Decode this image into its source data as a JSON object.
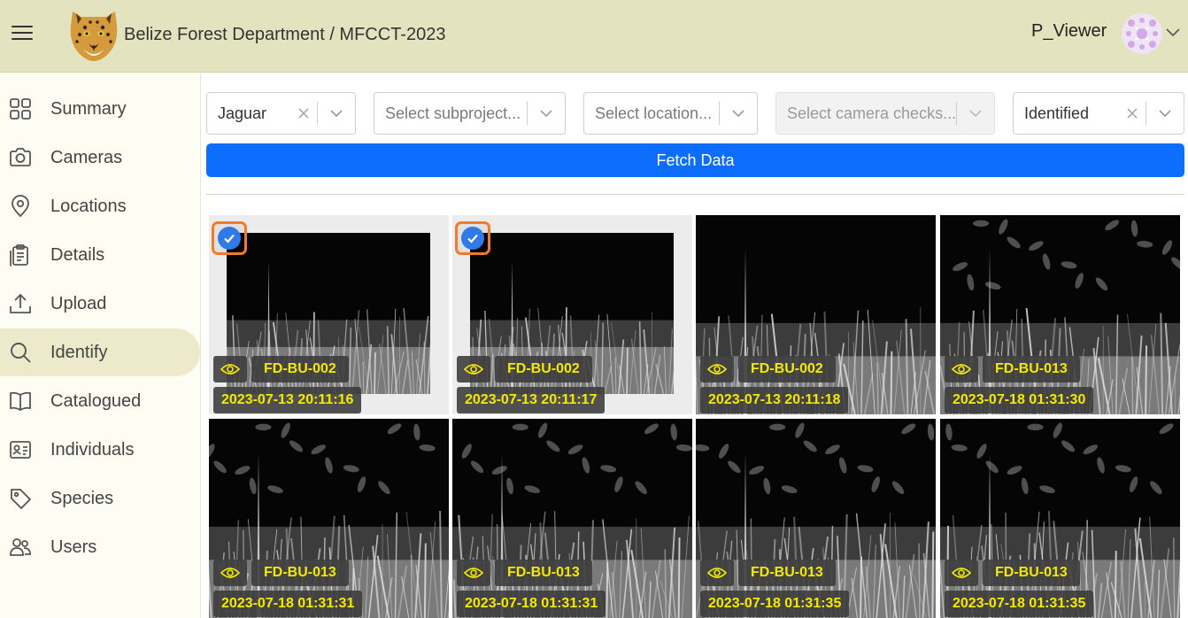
{
  "header": {
    "title": "Belize Forest Department / MFCCT-2023",
    "username": "P_Viewer",
    "menu_icon": "hamburger-menu-icon",
    "logo": "jaguar-logo"
  },
  "sidebar": {
    "items": [
      {
        "label": "Summary",
        "icon": "grid-icon"
      },
      {
        "label": "Cameras",
        "icon": "camera-icon"
      },
      {
        "label": "Locations",
        "icon": "map-pin-icon"
      },
      {
        "label": "Details",
        "icon": "clipboard-icon"
      },
      {
        "label": "Upload",
        "icon": "upload-icon"
      },
      {
        "label": "Identify",
        "icon": "search-icon",
        "active": true
      },
      {
        "label": "Catalogued",
        "icon": "book-icon"
      },
      {
        "label": "Individuals",
        "icon": "id-card-icon"
      },
      {
        "label": "Species",
        "icon": "tag-icon"
      },
      {
        "label": "Users",
        "icon": "users-icon"
      }
    ]
  },
  "filters": {
    "species": {
      "value": "Jaguar"
    },
    "subproject": {
      "placeholder": "Select subproject..."
    },
    "location": {
      "placeholder": "Select location..."
    },
    "camera_checks": {
      "placeholder": "Select camera checks...",
      "disabled": true
    },
    "status": {
      "value": "Identified"
    }
  },
  "fetch_button": {
    "label": "Fetch Data"
  },
  "images": [
    {
      "location": "FD-BU-002",
      "timestamp": "2023-07-13 20:11:16",
      "selected": true
    },
    {
      "location": "FD-BU-002",
      "timestamp": "2023-07-13 20:11:17",
      "selected": true
    },
    {
      "location": "FD-BU-002",
      "timestamp": "2023-07-13 20:11:18",
      "selected": false
    },
    {
      "location": "FD-BU-013",
      "timestamp": "2023-07-18 01:31:30",
      "selected": false
    },
    {
      "location": "FD-BU-013",
      "timestamp": "2023-07-18 01:31:31",
      "selected": false
    },
    {
      "location": "FD-BU-013",
      "timestamp": "2023-07-18 01:31:31",
      "selected": false
    },
    {
      "location": "FD-BU-013",
      "timestamp": "2023-07-18 01:31:35",
      "selected": false
    },
    {
      "location": "FD-BU-013",
      "timestamp": "2023-07-18 01:31:35",
      "selected": false
    }
  ],
  "colors": {
    "accent": "#0d6efd",
    "header_bg": "#e4e3bf",
    "badge_text": "#f4e900",
    "selection_border": "#f07b2a"
  }
}
